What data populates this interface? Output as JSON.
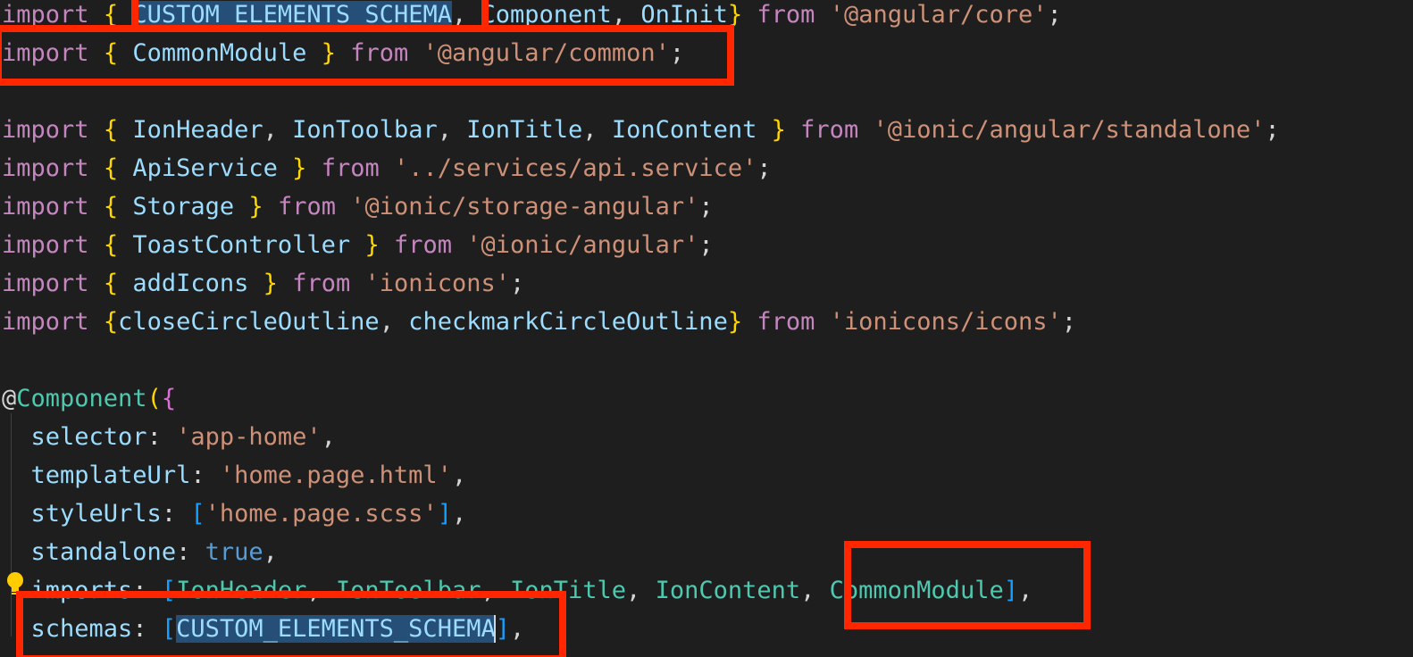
{
  "editor": {
    "theme_colors": {
      "background": "#1e1e1e",
      "keyword": "#c586c0",
      "string": "#ce9178",
      "identifier": "#9cdcfe",
      "class": "#4ec9b0",
      "boolean": "#569cd6",
      "bracket": "#ffd700",
      "highlight_box": "#ff2600"
    },
    "lightbulb_icon": "lightbulb-icon",
    "tokens": {
      "import": "import",
      "from": "from",
      "l1_names": [
        "CUSTOM_ELEMENTS_SCHEMA",
        "Component",
        "OnInit"
      ],
      "l1_src": "'@angular/core'",
      "l2_name": "CommonModule",
      "l2_src": "'@angular/common'",
      "l4_names": [
        "IonHeader",
        "IonToolbar",
        "IonTitle",
        "IonContent"
      ],
      "l4_src": "'@ionic/angular/standalone'",
      "l5_name": "ApiService",
      "l5_src": "'../services/api.service'",
      "l6_name": "Storage",
      "l6_src": "'@ionic/storage-angular'",
      "l7_name": "ToastController",
      "l7_src": "'@ionic/angular'",
      "l8_name": "addIcons",
      "l8_src": "'ionicons'",
      "l9_names": [
        "closeCircleOutline",
        "checkmarkCircleOutline"
      ],
      "l9_src": "'ionicons/icons'",
      "decorator_at": "@",
      "decorator_name": "Component",
      "selector_key": "selector",
      "selector_val": "'app-home'",
      "templateUrl_key": "templateUrl",
      "templateUrl_val": "'home.page.html'",
      "styleUrls_key": "styleUrls",
      "styleUrls_val": "'home.page.scss'",
      "standalone_key": "standalone",
      "standalone_val": "true",
      "imports_key": "imports",
      "imports_vals": [
        "IonHeader",
        "IonToolbar",
        "IonTitle",
        "IonContent",
        "CommonModule"
      ],
      "schemas_key": "schemas",
      "schemas_val": "CUSTOM_ELEMENTS_SCHEMA"
    }
  }
}
